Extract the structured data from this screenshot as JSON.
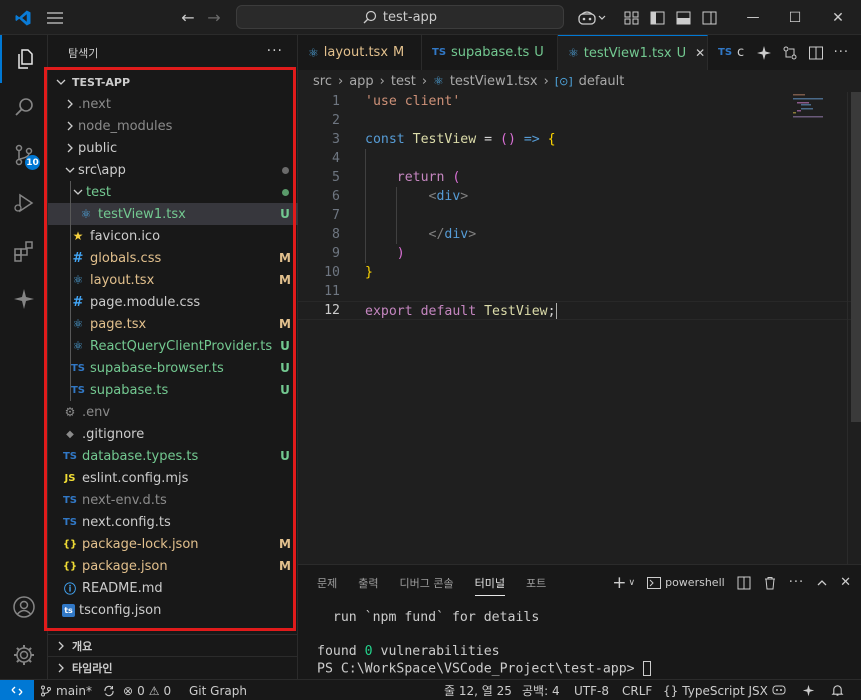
{
  "titlebar": {
    "search_text": "test-app",
    "nav_back": "←",
    "nav_forward": "→",
    "minimize": "—",
    "maximize": "☐",
    "close": "✕"
  },
  "activity": {
    "scm_badge": "10"
  },
  "sidebar": {
    "title": "탐색기",
    "more": "···",
    "project": "TEST-APP",
    "items": [
      {
        "label": ".next",
        "type": "folder",
        "decoration": "",
        "color": "#8b8b8b"
      },
      {
        "label": "node_modules",
        "type": "folder",
        "decoration": "",
        "color": "#8b8b8b"
      },
      {
        "label": "public",
        "type": "folder",
        "decoration": "",
        "color": "#cccccc"
      },
      {
        "label": "src\\app",
        "type": "folder-open",
        "decoration": "dot",
        "color": "#cccccc"
      },
      {
        "label": "test",
        "type": "folder-open",
        "decoration": "dot-green",
        "color": "#73c991"
      },
      {
        "label": "testView1.tsx",
        "type": "react",
        "decoration": "U",
        "color": "#73c991"
      },
      {
        "label": "favicon.ico",
        "type": "star",
        "decoration": "",
        "color": "#cccccc"
      },
      {
        "label": "globals.css",
        "type": "css",
        "decoration": "M",
        "color": "#e2c08d"
      },
      {
        "label": "layout.tsx",
        "type": "react",
        "decoration": "M",
        "color": "#e2c08d"
      },
      {
        "label": "page.module.css",
        "type": "css",
        "decoration": "",
        "color": "#cccccc"
      },
      {
        "label": "page.tsx",
        "type": "react",
        "decoration": "M",
        "color": "#e2c08d"
      },
      {
        "label": "ReactQueryClientProvider.tsx",
        "type": "react",
        "decoration": "U",
        "color": "#73c991"
      },
      {
        "label": "supabase-browser.ts",
        "type": "ts",
        "decoration": "U",
        "color": "#73c991"
      },
      {
        "label": "supabase.ts",
        "type": "ts",
        "decoration": "U",
        "color": "#73c991"
      },
      {
        "label": ".env",
        "type": "gear",
        "decoration": "",
        "color": "#8b8b8b"
      },
      {
        "label": ".gitignore",
        "type": "git",
        "decoration": "",
        "color": "#cccccc"
      },
      {
        "label": "database.types.ts",
        "type": "ts",
        "decoration": "U",
        "color": "#73c991"
      },
      {
        "label": "eslint.config.mjs",
        "type": "js",
        "decoration": "",
        "color": "#cccccc"
      },
      {
        "label": "next-env.d.ts",
        "type": "ts",
        "decoration": "",
        "color": "#8b8b8b"
      },
      {
        "label": "next.config.ts",
        "type": "ts",
        "decoration": "",
        "color": "#cccccc"
      },
      {
        "label": "package-lock.json",
        "type": "json",
        "decoration": "M",
        "color": "#e2c08d"
      },
      {
        "label": "package.json",
        "type": "json",
        "decoration": "M",
        "color": "#e2c08d"
      },
      {
        "label": "README.md",
        "type": "info",
        "decoration": "",
        "color": "#cccccc"
      },
      {
        "label": "tsconfig.json",
        "type": "tsconfig",
        "decoration": "",
        "color": "#cccccc"
      }
    ],
    "outline": "개요",
    "timeline": "타임라인"
  },
  "tabs": [
    {
      "label": "layout.tsx",
      "status": "M",
      "status_color": "#e2c08d",
      "icon": "react"
    },
    {
      "label": "supabase.ts",
      "status": "U",
      "status_color": "#73c991",
      "icon": "ts"
    },
    {
      "label": "testView1.tsx",
      "status": "U",
      "status_color": "#73c991",
      "icon": "react",
      "active": true
    },
    {
      "label": "c",
      "status": "",
      "status_color": "",
      "icon": "ts"
    }
  ],
  "breadcrumb": {
    "parts": [
      "src",
      "app",
      "test",
      "testView1.tsx",
      "default"
    ]
  },
  "editor": {
    "current_line": 12,
    "lines": [
      {
        "n": "1",
        "tokens": [
          {
            "t": "'use client'",
            "c": "#ce9178"
          }
        ]
      },
      {
        "n": "2",
        "tokens": []
      },
      {
        "n": "3",
        "tokens": [
          {
            "t": "const ",
            "c": "#569cd6"
          },
          {
            "t": "TestView",
            "c": "#dcdcaa"
          },
          {
            "t": " = ",
            "c": "#d4d4d4"
          },
          {
            "t": "()",
            "c": "#da70d6"
          },
          {
            "t": " => ",
            "c": "#569cd6"
          },
          {
            "t": "{",
            "c": "#ffd700"
          }
        ]
      },
      {
        "n": "4",
        "tokens": []
      },
      {
        "n": "5",
        "tokens": [
          {
            "t": "    return ",
            "c": "#c586c0"
          },
          {
            "t": "(",
            "c": "#da70d6"
          }
        ]
      },
      {
        "n": "6",
        "tokens": [
          {
            "t": "        <",
            "c": "#808080"
          },
          {
            "t": "div",
            "c": "#569cd6"
          },
          {
            "t": ">",
            "c": "#808080"
          }
        ]
      },
      {
        "n": "7",
        "tokens": []
      },
      {
        "n": "8",
        "tokens": [
          {
            "t": "        </",
            "c": "#808080"
          },
          {
            "t": "div",
            "c": "#569cd6"
          },
          {
            "t": ">",
            "c": "#808080"
          }
        ]
      },
      {
        "n": "9",
        "tokens": [
          {
            "t": "    )",
            "c": "#da70d6"
          }
        ]
      },
      {
        "n": "10",
        "tokens": [
          {
            "t": "}",
            "c": "#ffd700"
          }
        ]
      },
      {
        "n": "11",
        "tokens": []
      },
      {
        "n": "12",
        "tokens": [
          {
            "t": "export ",
            "c": "#c586c0"
          },
          {
            "t": "default ",
            "c": "#c586c0"
          },
          {
            "t": "TestView",
            "c": "#dcdcaa"
          },
          {
            "t": ";",
            "c": "#d4d4d4"
          }
        ]
      }
    ]
  },
  "panel": {
    "tabs": [
      "문제",
      "출력",
      "디버그 콘솔",
      "터미널",
      "포트"
    ],
    "active_tab": "터미널",
    "shell": "powershell",
    "terminal": [
      "  run `npm fund` for details",
      "",
      "found 0 vulnerabilities",
      "PS C:\\WorkSpace\\VSCode_Project\\test-app> "
    ]
  },
  "statusbar": {
    "branch": "main*",
    "errors": "0",
    "warnings": "0",
    "git_graph": "Git Graph",
    "position": "줄 12, 열 25",
    "spaces": "공백: 4",
    "encoding": "UTF-8",
    "eol": "CRLF",
    "language": "TypeScript JSX"
  },
  "colors": {
    "accent": "#0078d4",
    "highlight_frame": "#e01b1b",
    "untracked": "#73c991",
    "modified": "#e2c08d"
  }
}
